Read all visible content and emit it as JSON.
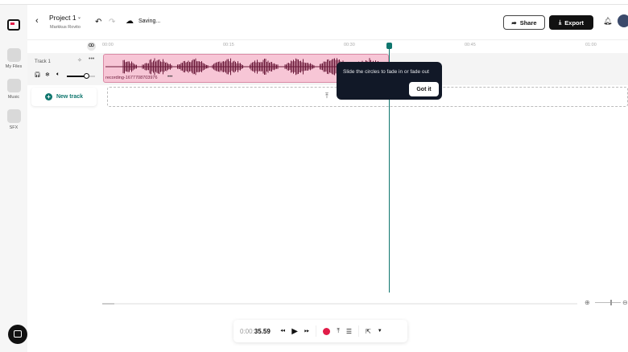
{
  "header": {
    "project_title": "Project 1",
    "owner": "Markkus Rovito",
    "save_status": "Saving...",
    "share_label": "Share",
    "export_label": "Export"
  },
  "rail": [
    {
      "label": "My Files",
      "icon": "file-icon"
    },
    {
      "label": "Music",
      "icon": "music-icon"
    },
    {
      "label": "SFX",
      "icon": "sfx-icon"
    }
  ],
  "ruler": [
    "00:00",
    "00:15",
    "00:30",
    "00:45",
    "01:00"
  ],
  "track": {
    "name": "Track 1",
    "clip_name": "recording-1677708703976",
    "volume": 0.7
  },
  "new_track_label": "New track",
  "tooltip": {
    "text": "Slide the circles to fade in or fade out",
    "button": "Got it"
  },
  "transport": {
    "time_prefix": "0:00:",
    "time_main": "35.59"
  },
  "colors": {
    "accent": "#0f766e",
    "clip": "#f7c6d6",
    "waveform": "#6b1a3a",
    "record": "#e11d48"
  }
}
